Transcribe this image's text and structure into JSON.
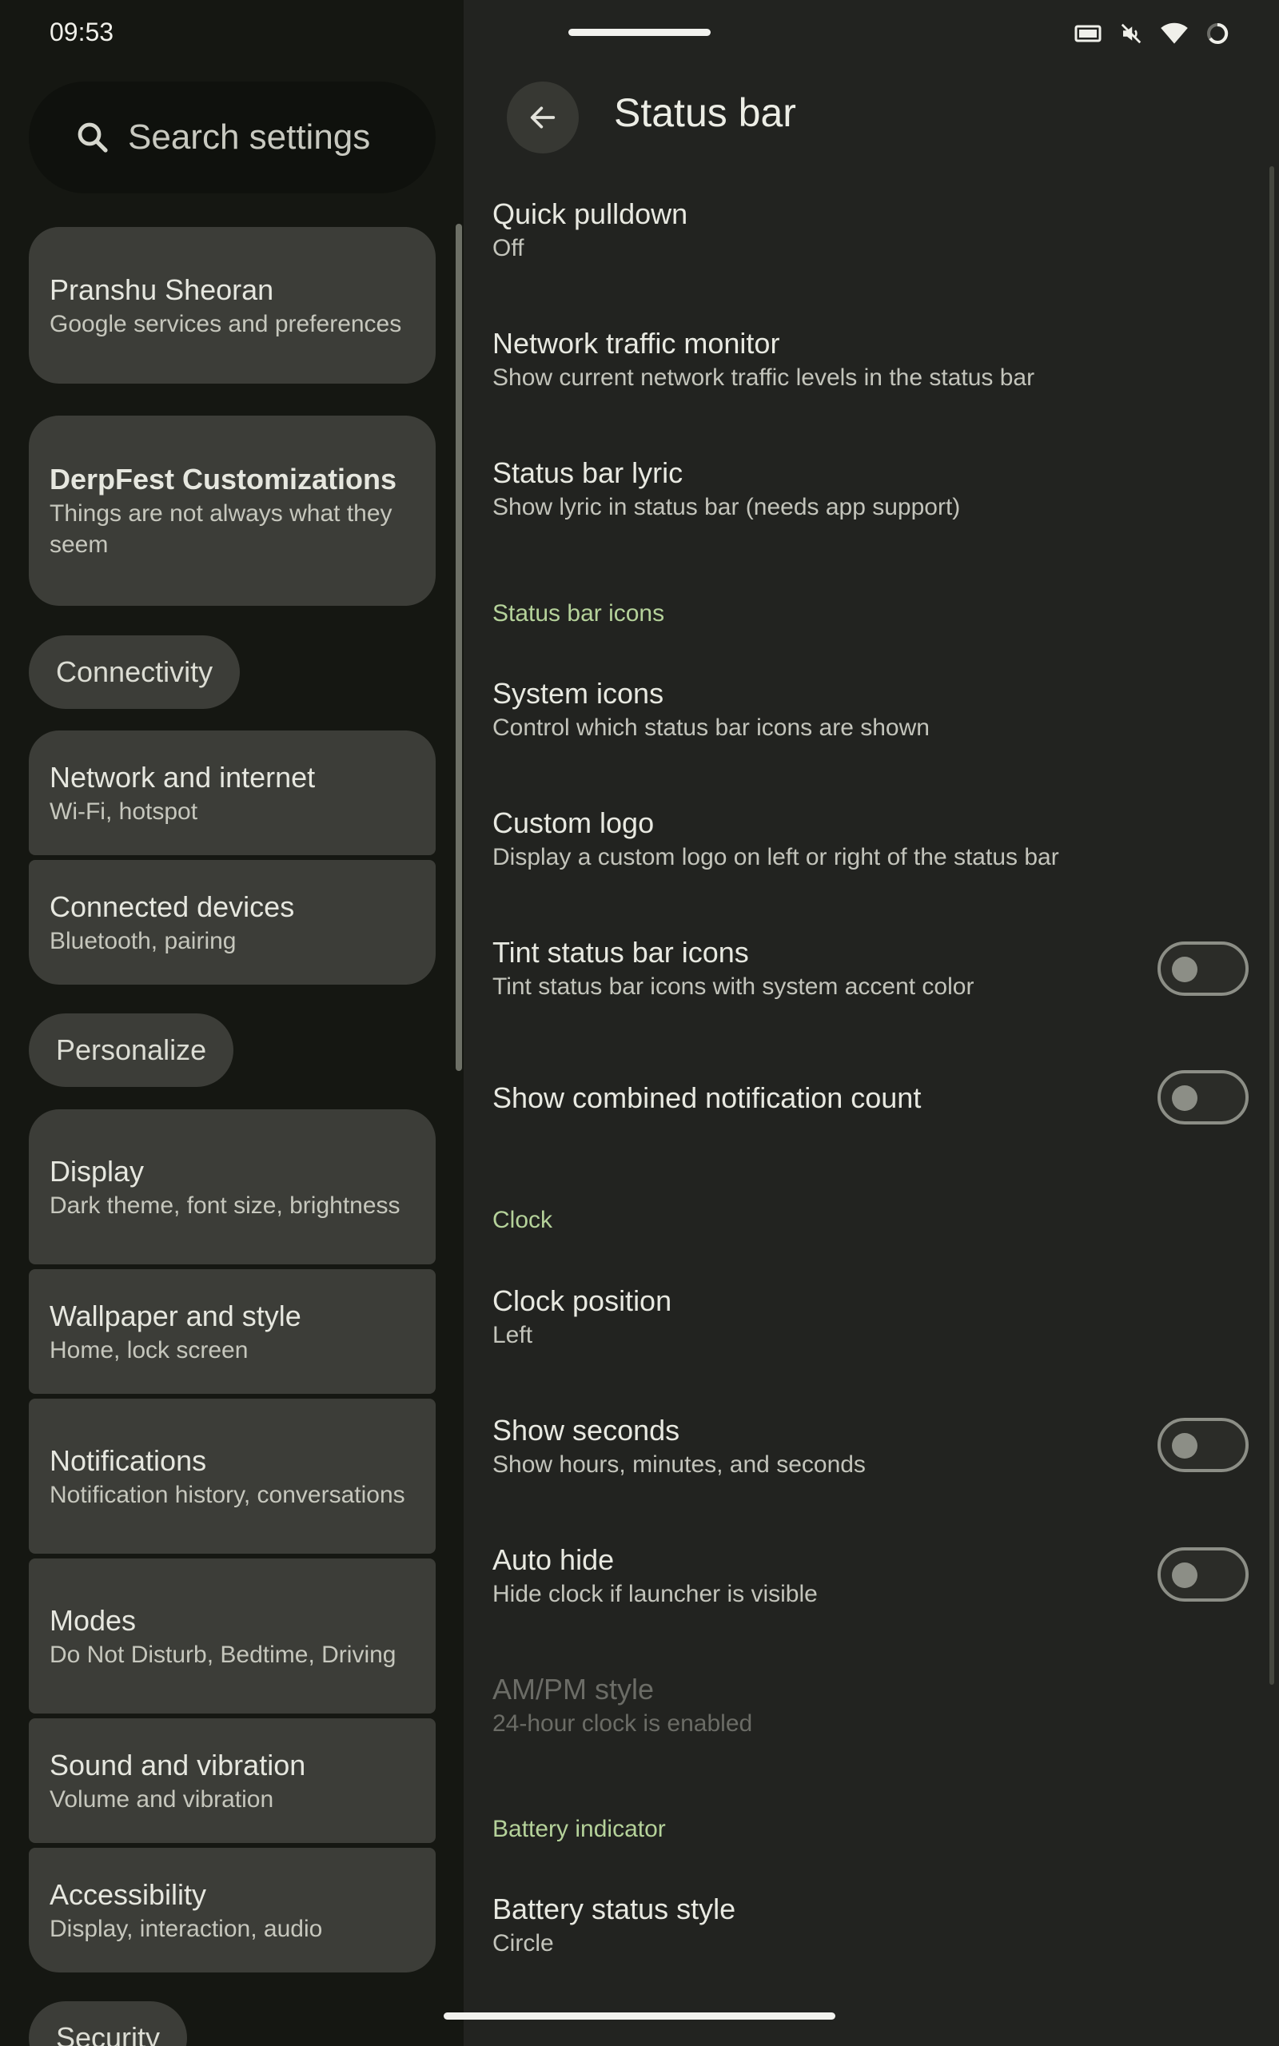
{
  "status_bar": {
    "time": "09:53",
    "icons": [
      "screen-cast-icon",
      "muted-icon",
      "wifi-icon",
      "battery-circle-icon"
    ]
  },
  "sidebar": {
    "search_label": "Search settings",
    "account": {
      "title": "Pranshu Sheoran",
      "subtitle": "Google services and preferences"
    },
    "derpfest": {
      "title": "DerpFest Customizations",
      "subtitle": "Things are not always what they seem"
    },
    "chips": {
      "connectivity": "Connectivity",
      "personalize": "Personalize",
      "security": "Security"
    },
    "connectivity_items": [
      {
        "title": "Network and internet",
        "subtitle": "Wi-Fi, hotspot"
      },
      {
        "title": "Connected devices",
        "subtitle": "Bluetooth, pairing"
      }
    ],
    "personalize_items": [
      {
        "title": "Display",
        "subtitle": "Dark theme, font size, brightness"
      },
      {
        "title": "Wallpaper and style",
        "subtitle": "Home, lock screen"
      },
      {
        "title": "Notifications",
        "subtitle": "Notification history, conversations"
      },
      {
        "title": "Modes",
        "subtitle": "Do Not Disturb, Bedtime, Driving"
      },
      {
        "title": "Sound and vibration",
        "subtitle": "Volume and vibration"
      },
      {
        "title": "Accessibility",
        "subtitle": "Display, interaction, audio"
      }
    ]
  },
  "main": {
    "title": "Status bar",
    "items": {
      "quick_pulldown": {
        "title": "Quick pulldown",
        "subtitle": "Off"
      },
      "network_traffic": {
        "title": "Network traffic monitor",
        "subtitle": "Show current network traffic levels in the status bar"
      },
      "status_lyric": {
        "title": "Status bar lyric",
        "subtitle": "Show lyric in status bar (needs app support)"
      },
      "system_icons": {
        "title": "System icons",
        "subtitle": "Control which status bar icons are shown"
      },
      "custom_logo": {
        "title": "Custom logo",
        "subtitle": "Display a custom logo on left or right of the status bar"
      },
      "tint_icons": {
        "title": "Tint status bar icons",
        "subtitle": "Tint status bar icons with system accent color",
        "enabled": false
      },
      "combined_count": {
        "title": "Show combined notification count",
        "enabled": false
      },
      "clock_position": {
        "title": "Clock position",
        "subtitle": "Left"
      },
      "show_seconds": {
        "title": "Show seconds",
        "subtitle": "Show hours, minutes, and seconds",
        "enabled": false
      },
      "auto_hide": {
        "title": "Auto hide",
        "subtitle": "Hide clock if launcher is visible",
        "enabled": false
      },
      "ampm_style": {
        "title": "AM/PM style",
        "subtitle": "24-hour clock is enabled",
        "disabled": true
      },
      "battery_style": {
        "title": "Battery status style",
        "subtitle": "Circle"
      }
    },
    "sections": {
      "status_bar_icons": "Status bar icons",
      "clock": "Clock",
      "battery_indicator": "Battery indicator"
    }
  },
  "colors": {
    "accent_section": "#b5d29a",
    "pane_bg": "#222320",
    "sidebar_bg": "#151712",
    "card_bg": "#3c3d38"
  }
}
